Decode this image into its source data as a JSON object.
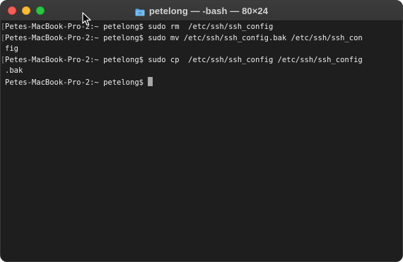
{
  "window": {
    "title": "petelong — -bash — 80×24",
    "title_icon": "folder-icon",
    "background": "#1e1e1e",
    "traffic_lights": {
      "close_color": "#fe5f57",
      "minimize_color": "#febc2e",
      "maximize_color": "#28c840"
    }
  },
  "terminal": {
    "lines": [
      "Petes-MacBook-Pro-2:~ petelong$ sudo rm  /etc/ssh/ssh_config",
      "Petes-MacBook-Pro-2:~ petelong$ sudo mv /etc/ssh/ssh_config.bak /etc/ssh/ssh_con",
      "fig",
      "Petes-MacBook-Pro-2:~ petelong$ sudo cp  /etc/ssh/ssh_config /etc/ssh/ssh_config",
      ".bak",
      "Petes-MacBook-Pro-2:~ petelong$"
    ],
    "text_color": "#ececec",
    "cursor_color": "#a8a8a8"
  }
}
